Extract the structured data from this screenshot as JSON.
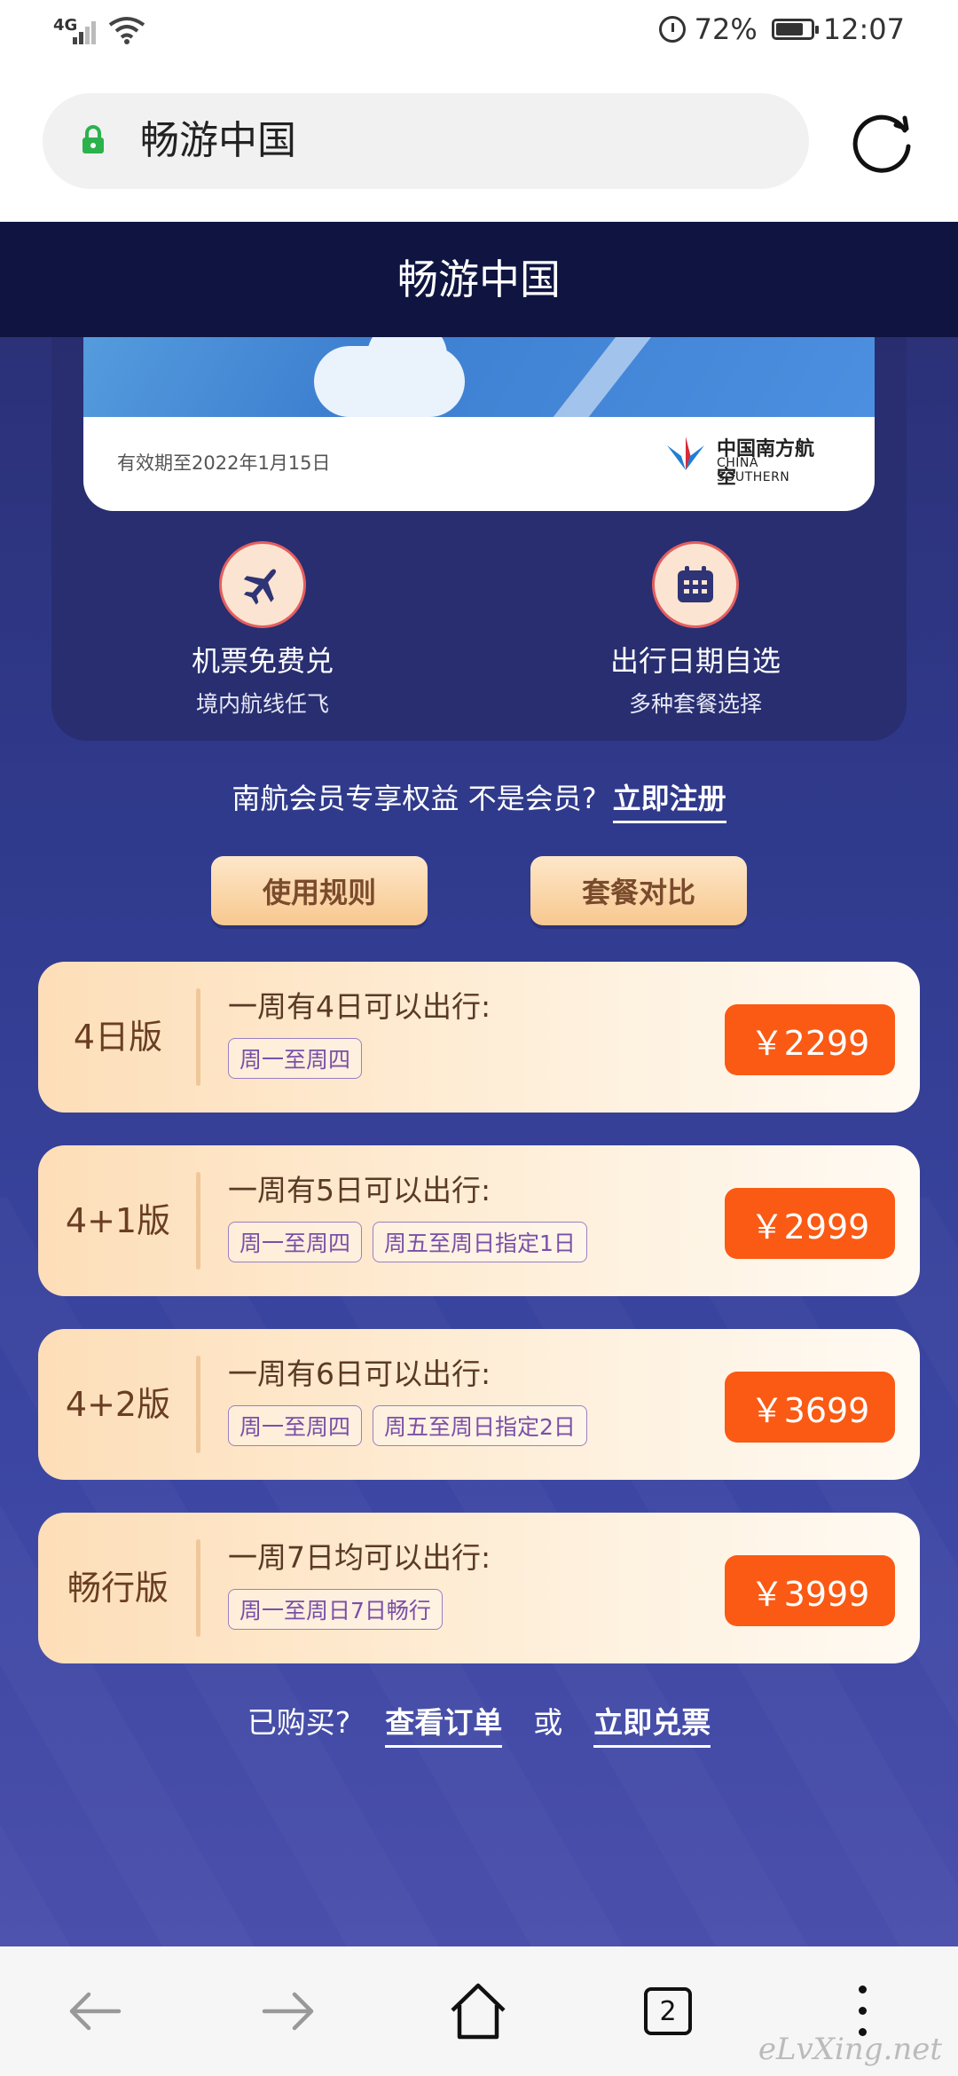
{
  "status_bar": {
    "network": "4G",
    "battery_percent": "72%",
    "time": "12:07",
    "battery_level": 0.72
  },
  "address_bar": {
    "url_text": "畅游中国",
    "icons": [
      "lock-icon",
      "reload-icon"
    ]
  },
  "page_title": "畅游中国",
  "card": {
    "validity": "有效期至2022年1月15日",
    "brand_cn": "中国南方航空",
    "brand_en": "CHINA SOUTHERN"
  },
  "features": [
    {
      "icon": "airplane-icon",
      "title": "机票免费兑",
      "subtitle": "境内航线任飞"
    },
    {
      "icon": "calendar-icon",
      "title": "出行日期自选",
      "subtitle": "多种套餐选择"
    }
  ],
  "member": {
    "text": "南航会员专享权益 不是会员?",
    "register": "立即注册"
  },
  "buttons": {
    "rules": "使用规则",
    "compare": "套餐对比"
  },
  "plans": [
    {
      "name": "4日版",
      "desc": "一周有4日可以出行:",
      "tags": [
        "周一至周四"
      ],
      "price": "￥2299"
    },
    {
      "name": "4+1版",
      "desc": "一周有5日可以出行:",
      "tags": [
        "周一至周四",
        "周五至周日指定1日"
      ],
      "price": "￥2999"
    },
    {
      "name": "4+2版",
      "desc": "一周有6日可以出行:",
      "tags": [
        "周一至周四",
        "周五至周日指定2日"
      ],
      "price": "￥3699"
    },
    {
      "name": "畅行版",
      "desc": "一周7日均可以出行:",
      "tags": [
        "周一至周日7日畅行"
      ],
      "price": "￥3999"
    }
  ],
  "bought": {
    "prefix": "已购买?",
    "orders": "查看订单",
    "or": "或",
    "redeem": "立即兑票"
  },
  "nav": {
    "tab_count": "2",
    "icons": [
      "back-icon",
      "forward-icon",
      "home-icon",
      "tabs-icon",
      "menu-icon"
    ]
  },
  "watermark": "eLvXing.net",
  "colors": {
    "titlebar": "#0f1540",
    "price": "#fa5a14",
    "page_bg": "#303a8c"
  }
}
